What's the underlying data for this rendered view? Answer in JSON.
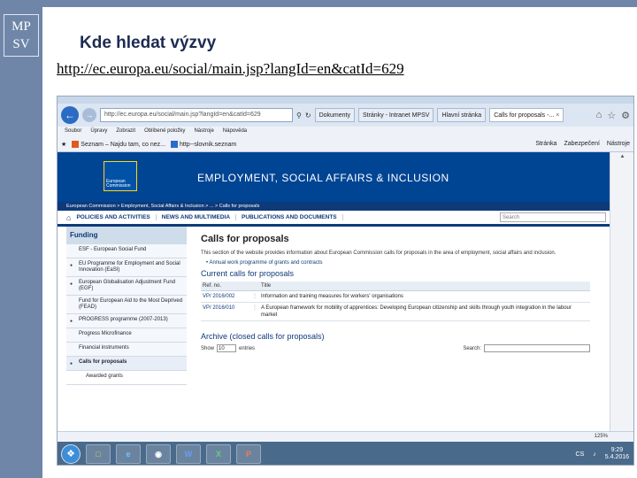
{
  "slide": {
    "logo_lines": [
      "MP",
      "SV"
    ],
    "title": "Kde hledat výzvy",
    "url": "http://ec.europa.eu/social/main.jsp?langId=en&catId=629"
  },
  "browser": {
    "address": "http://ec.europa.eu/social/main.jsp?langId=en&catId=629",
    "tabs": [
      {
        "label": "Dokumenty"
      },
      {
        "label": "Stránky - Intranet MPSV"
      },
      {
        "label": "Hlavní stránka"
      },
      {
        "label": "Calls for proposals -...",
        "active": true
      }
    ],
    "menu": [
      "Soubor",
      "Úpravy",
      "Zobrazit",
      "Oblíbené položky",
      "Nástroje",
      "Nápověda"
    ],
    "favorites": [
      "Seznam – Najdu tam, co nez...",
      "http--slovnik.seznam"
    ],
    "fav_right": [
      "Stránka",
      "Zabezpečení",
      "Nástroje"
    ],
    "zoom": "125%"
  },
  "site": {
    "header_title": "EMPLOYMENT, SOCIAL AFFAIRS & INCLUSION",
    "logo_text": "European Commission",
    "breadcrumb": "European Commission > Employment, Social Affairs & Inclusion > ... > Calls for proposals",
    "nav": [
      "POLICIES AND ACTIVITIES",
      "NEWS AND MULTIMEDIA",
      "PUBLICATIONS AND DOCUMENTS"
    ],
    "search_placeholder": "Search"
  },
  "sidebar": {
    "heading": "Funding",
    "items": [
      {
        "label": "ESF - European Social Fund"
      },
      {
        "label": "EU Programme for Employment and Social Innovation (EaSI)"
      },
      {
        "label": "European Globalisation Adjustment Fund (EGF)"
      },
      {
        "label": "Fund for European Aid to the Most Deprived (FEAD)"
      },
      {
        "label": "PROGRESS programme (2007-2013)"
      },
      {
        "label": "Progress Microfinance"
      },
      {
        "label": "Financial instruments"
      },
      {
        "label": "Calls for proposals",
        "active": true
      },
      {
        "label": "Awarded grants",
        "sub": true
      }
    ]
  },
  "content": {
    "heading": "Calls for proposals",
    "intro": "This section of the website provides information about European Commission calls for proposals in the area of employment, social affairs and inclusion.",
    "annual_link": "Annual work programme of grants and contracts",
    "current_heading": "Current calls for proposals",
    "table_headers": [
      "Ref. no.",
      "Title"
    ],
    "rows": [
      {
        "ref": "VP/ 2016/002",
        "title": "Information and training measures for workers' organisations"
      },
      {
        "ref": "VP/ 2016/010",
        "title": "A European framework for mobility of apprentices: Developing European citizenship and skills through youth integration in the labour market"
      }
    ],
    "archive_heading": "Archive (closed calls for proposals)",
    "show_label": "Show",
    "show_value": "10",
    "entries_label": "entries",
    "search_label": "Search:"
  },
  "taskbar": {
    "apps": [
      "folder",
      "ie",
      "chrome",
      "word",
      "excel",
      "ppt"
    ],
    "lang": "CS",
    "time": "9:29",
    "date": "5.4.2016"
  }
}
